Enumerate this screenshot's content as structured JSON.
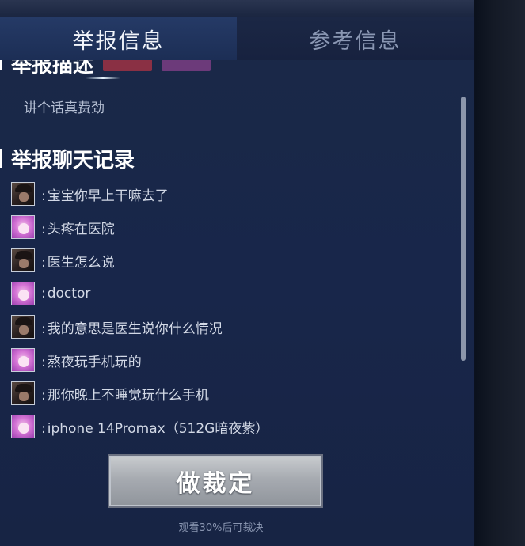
{
  "tabs": [
    {
      "label": "举报信息",
      "active": true
    },
    {
      "label": "参考信息",
      "active": false
    }
  ],
  "report": {
    "description_heading": "举报描述",
    "tags": [
      "",
      ""
    ],
    "description_text": "讲个话真费劲",
    "chat_heading": "举报聊天记录",
    "colon": ":",
    "messages": [
      {
        "avatar": "dark-hooded-avatar",
        "text": "宝宝你早上干嘛去了"
      },
      {
        "avatar": "pink-avatar",
        "text": "头疼在医院"
      },
      {
        "avatar": "dark-hooded-avatar",
        "text": "医生怎么说"
      },
      {
        "avatar": "pink-avatar",
        "text": "doctor"
      },
      {
        "avatar": "dark-hooded-avatar",
        "text": "我的意思是医生说你什么情况"
      },
      {
        "avatar": "pink-avatar",
        "text": "熬夜玩手机玩的"
      },
      {
        "avatar": "dark-hooded-avatar",
        "text": "那你晚上不睡觉玩什么手机"
      },
      {
        "avatar": "pink-avatar",
        "text": "iphone 14Promax（512G暗夜紫）"
      }
    ]
  },
  "action": {
    "button_label": "做裁定",
    "hint": "观看30%后可裁决"
  },
  "colors": {
    "panel_bg": "#1a2947",
    "active_tab_bg": "#253a66",
    "button_silver": "#a7abb1"
  }
}
